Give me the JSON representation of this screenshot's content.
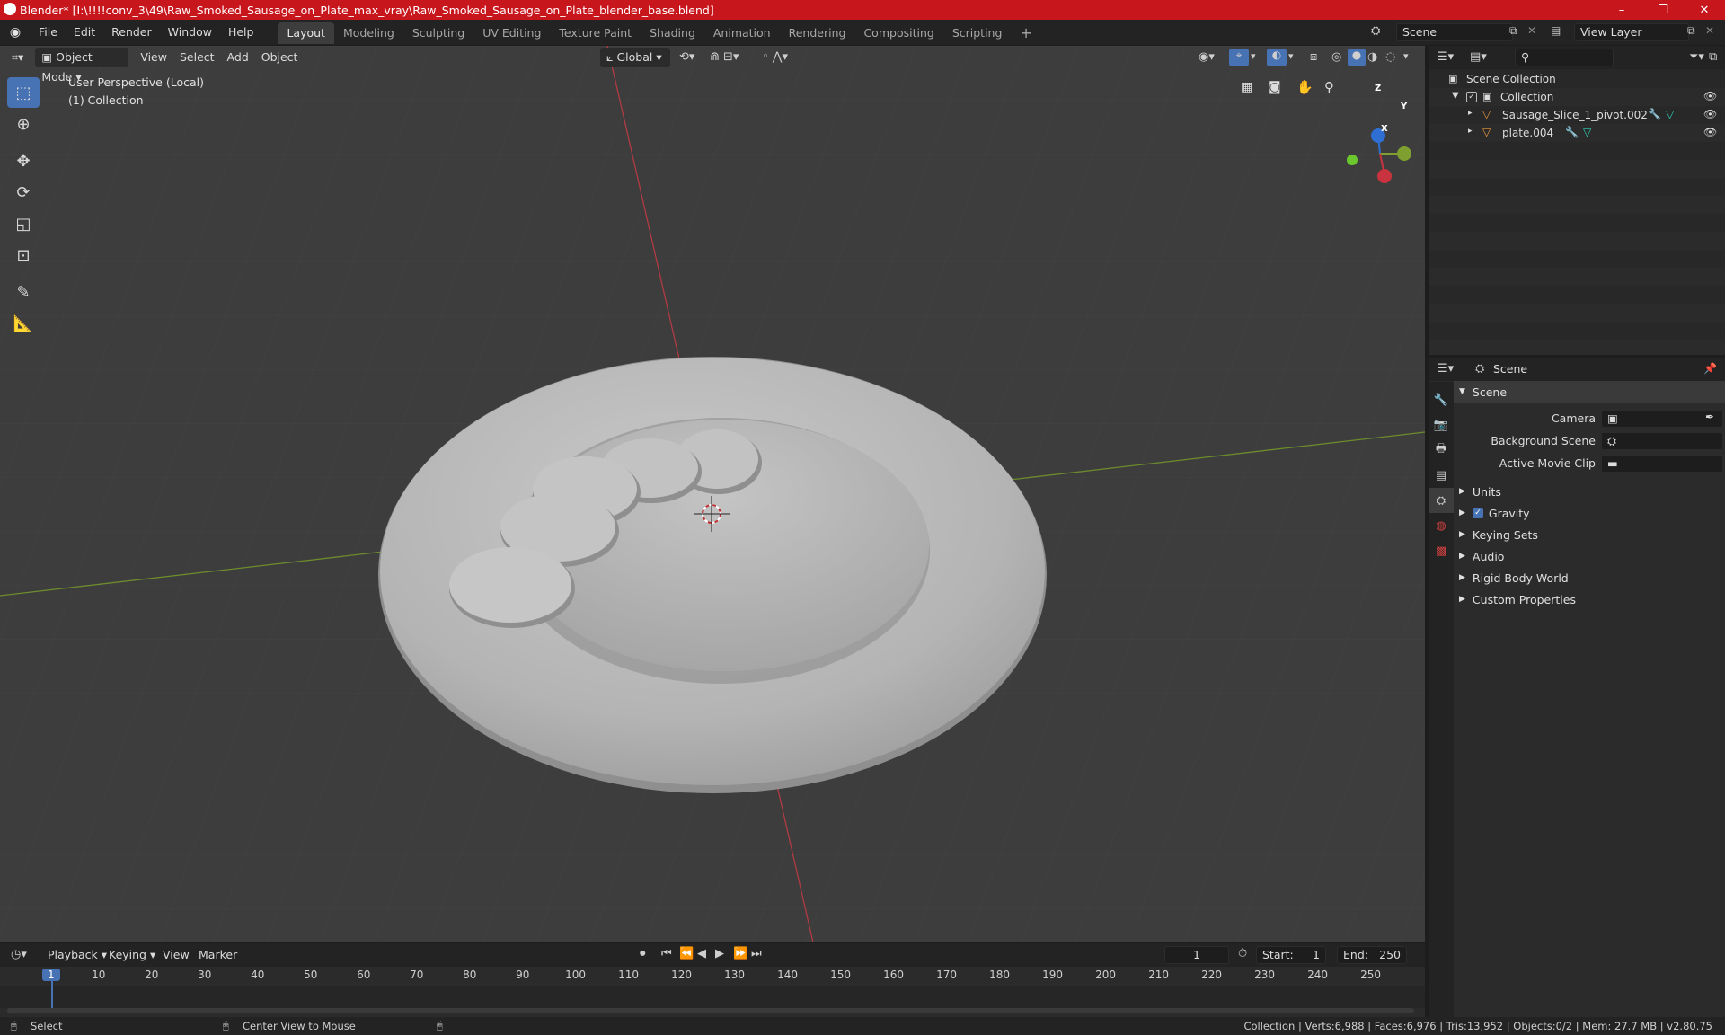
{
  "window": {
    "title": "Blender* [I:\\!!!!conv_3\\49\\Raw_Smoked_Sausage_on_Plate_max_vray\\Raw_Smoked_Sausage_on_Plate_blender_base.blend]",
    "controls": {
      "minimize": "–",
      "maximize": "❐",
      "close": "✕"
    }
  },
  "menu": {
    "items": [
      "File",
      "Edit",
      "Render",
      "Window",
      "Help"
    ]
  },
  "workspaces": [
    "Layout",
    "Modeling",
    "Sculpting",
    "UV Editing",
    "Texture Paint",
    "Shading",
    "Animation",
    "Rendering",
    "Compositing",
    "Scripting"
  ],
  "workspace_add": "+",
  "scene": {
    "name": "Scene",
    "view_layer": "View Layer"
  },
  "viewport": {
    "mode": "Object Mode",
    "menus": [
      "View",
      "Select",
      "Add",
      "Object"
    ],
    "transform_orientation": "Global",
    "perspective_label": "User Perspective (Local)",
    "collection_label": "(1) Collection",
    "gizmo": {
      "z": "Z",
      "y": "Y",
      "x": "X"
    }
  },
  "outliner": {
    "root": "Scene Collection",
    "collection": "Collection",
    "objects": [
      "Sausage_Slice_1_pivot.002",
      "plate.004"
    ]
  },
  "properties": {
    "breadcrumb": "Scene",
    "panel_title": "Scene",
    "fields": [
      {
        "label": "Camera",
        "value": ""
      },
      {
        "label": "Background Scene",
        "value": ""
      },
      {
        "label": "Active Movie Clip",
        "value": ""
      }
    ],
    "subpanels": [
      "Units",
      "Gravity",
      "Keying Sets",
      "Audio",
      "Rigid Body World",
      "Custom Properties"
    ],
    "gravity_checked": true
  },
  "timeline": {
    "menus": [
      "Playback",
      "Keying",
      "View",
      "Marker"
    ],
    "current_frame": "1",
    "start_label": "Start:",
    "start": "1",
    "end_label": "End:",
    "end": "250",
    "ticks": [
      "1",
      "10",
      "20",
      "30",
      "40",
      "50",
      "60",
      "70",
      "80",
      "90",
      "100",
      "110",
      "120",
      "130",
      "140",
      "150",
      "160",
      "170",
      "180",
      "190",
      "200",
      "210",
      "220",
      "230",
      "240",
      "250"
    ]
  },
  "statusbar": {
    "left_action": "Select",
    "middle_action": "Center View to Mouse",
    "stats": "Collection | Verts:6,988 | Faces:6,976 | Tris:13,952 | Objects:0/2 | Mem: 27.7 MB | v2.80.75"
  },
  "colors": {
    "title_bar": "#c8161d",
    "accent": "#4772b3",
    "x_axis": "#c8333f",
    "y_axis": "#7fa030",
    "z_axis": "#2f6fd3",
    "viewport_bg": "#3d3d3d"
  }
}
